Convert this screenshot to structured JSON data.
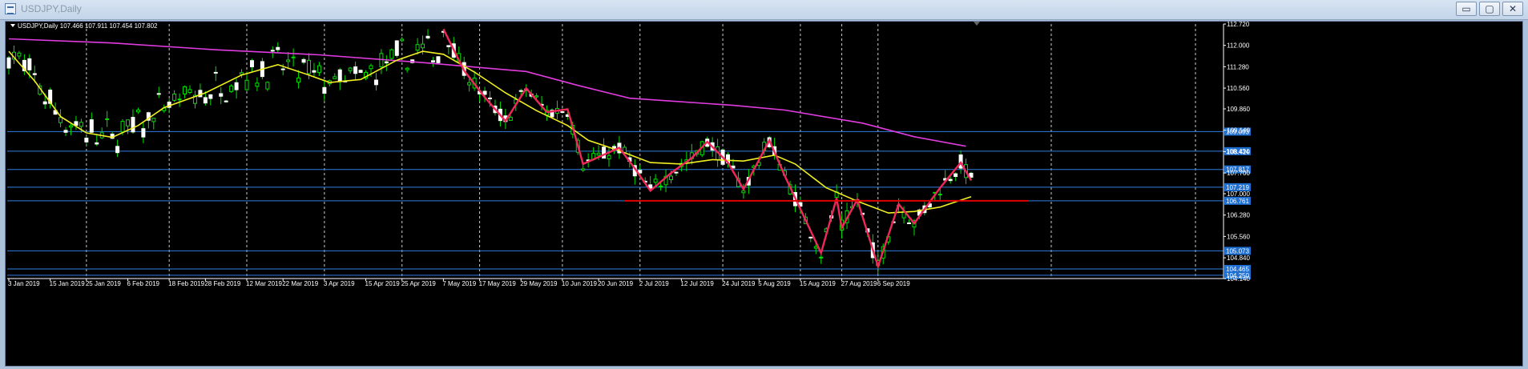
{
  "window": {
    "title": "USDJPY,Daily",
    "btn_min": "▭",
    "btn_max": "▢",
    "btn_close": "✕"
  },
  "chart_data": {
    "type": "candlestick",
    "symbol": "USDJPY",
    "timeframe": "Daily",
    "header": "USDJPY,Daily  107.466 107.911 107.454 107.802",
    "ohlc_last": {
      "open": 107.466,
      "high": 107.911,
      "low": 107.454,
      "close": 107.802
    },
    "ylim": [
      104.14,
      112.72
    ],
    "y_ticks": [
      "112.720",
      "112.000",
      "111.280",
      "110.560",
      "109.860",
      "109.140",
      "108.420",
      "107.700",
      "107.000",
      "106.280",
      "105.560",
      "104.840",
      "104.140"
    ],
    "x_ticks": [
      "3 Jan 2019",
      "15 Jan 2019",
      "25 Jan 2019",
      "6 Feb 2019",
      "18 Feb 2019",
      "28 Feb 2019",
      "12 Mar 2019",
      "22 Mar 2019",
      "3 Apr 2019",
      "15 Apr 2019",
      "25 Apr 2019",
      "7 May 2019",
      "17 May 2019",
      "29 May 2019",
      "10 Jun 2019",
      "20 Jun 2019",
      "2 Jul 2019",
      "12 Jul 2019",
      "24 Jul 2019",
      "5 Aug 2019",
      "15 Aug 2019",
      "27 Aug 2019",
      "6 Sep 2019"
    ],
    "grid": "vertical dashed",
    "horizontal_levels": [
      {
        "value": 109.093,
        "label": "109.093"
      },
      {
        "value": 108.434,
        "label": "108.434"
      },
      {
        "value": 107.817,
        "label": "107.817"
      },
      {
        "value": 107.219,
        "label": "107.219"
      },
      {
        "value": 106.761,
        "label": "106.761"
      },
      {
        "value": 105.073,
        "label": "105.073"
      },
      {
        "value": 104.465,
        "label": "104.465"
      },
      {
        "value": 104.25,
        "label": "104.250"
      }
    ],
    "support_line": {
      "value": 106.761,
      "from_index": 119,
      "to_index": 197
    },
    "ma_slow": [
      [
        0,
        112.22
      ],
      [
        20,
        112.08
      ],
      [
        40,
        111.85
      ],
      [
        60,
        111.68
      ],
      [
        80,
        111.42
      ],
      [
        100,
        111.12
      ],
      [
        110,
        110.65
      ],
      [
        120,
        110.22
      ],
      [
        140,
        109.98
      ],
      [
        150,
        109.82
      ],
      [
        165,
        109.38
      ],
      [
        175,
        108.92
      ],
      [
        185,
        108.6
      ]
    ],
    "ma_fast": [
      [
        0,
        111.8
      ],
      [
        5,
        110.8
      ],
      [
        10,
        109.6
      ],
      [
        15,
        109.05
      ],
      [
        20,
        108.9
      ],
      [
        25,
        109.3
      ],
      [
        30,
        109.9
      ],
      [
        38,
        110.4
      ],
      [
        45,
        111.0
      ],
      [
        52,
        111.35
      ],
      [
        58,
        111.0
      ],
      [
        62,
        110.75
      ],
      [
        68,
        110.85
      ],
      [
        75,
        111.5
      ],
      [
        80,
        111.8
      ],
      [
        84,
        111.7
      ],
      [
        90,
        111.1
      ],
      [
        96,
        110.4
      ],
      [
        102,
        109.8
      ],
      [
        108,
        109.3
      ],
      [
        112,
        108.8
      ],
      [
        118,
        108.45
      ],
      [
        124,
        108.05
      ],
      [
        130,
        108.0
      ],
      [
        136,
        108.15
      ],
      [
        142,
        108.1
      ],
      [
        148,
        108.3
      ],
      [
        152,
        108.0
      ],
      [
        158,
        107.2
      ],
      [
        164,
        106.75
      ],
      [
        170,
        106.35
      ],
      [
        175,
        106.4
      ],
      [
        180,
        106.55
      ],
      [
        186,
        106.9
      ]
    ],
    "zigzag": [
      [
        84,
        112.55
      ],
      [
        88,
        111.15
      ],
      [
        92,
        110.25
      ],
      [
        96,
        109.45
      ],
      [
        100,
        110.55
      ],
      [
        104,
        109.75
      ],
      [
        108,
        109.85
      ],
      [
        111,
        108.0
      ],
      [
        118,
        108.55
      ],
      [
        121,
        107.85
      ],
      [
        124,
        107.1
      ],
      [
        128,
        107.7
      ],
      [
        132,
        108.2
      ],
      [
        135,
        108.75
      ],
      [
        139,
        108.05
      ],
      [
        142,
        107.15
      ],
      [
        147,
        108.8
      ],
      [
        150,
        107.6
      ],
      [
        157,
        105.0
      ],
      [
        160,
        106.85
      ],
      [
        161,
        105.85
      ],
      [
        164,
        106.8
      ],
      [
        168,
        104.55
      ],
      [
        172,
        106.65
      ],
      [
        175,
        106.0
      ],
      [
        180,
        107.2
      ],
      [
        184,
        108.05
      ],
      [
        186,
        107.45
      ]
    ],
    "candle_count": 187
  }
}
